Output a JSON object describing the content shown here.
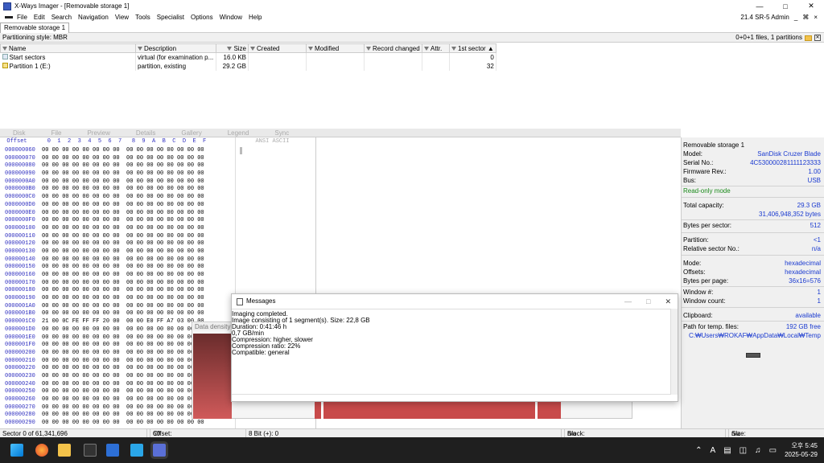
{
  "window": {
    "title": "X-Ways Imager - [Removable storage 1]",
    "version_label": "21.4 SR-5 Admin"
  },
  "menu": [
    "File",
    "Edit",
    "Search",
    "Navigation",
    "View",
    "Tools",
    "Specialist",
    "Options",
    "Window",
    "Help"
  ],
  "menu_right": {
    "minimize": "_",
    "restore": "×",
    "extra": "⌘"
  },
  "tab": {
    "label": "Removable storage 1"
  },
  "infobar": {
    "left": "Partitioning style: MBR",
    "right": "0+0+1 files, 1 partitions"
  },
  "filelist": {
    "columns": [
      "Name",
      "Description",
      "Size",
      "Created",
      "Modified",
      "Record changed",
      "Attr.",
      "1st sector"
    ],
    "rows": [
      {
        "name": "Start sectors",
        "description": "virtual (for examination p...",
        "size": "16.0 KB",
        "created": "",
        "modified": "",
        "record": "",
        "attr": "",
        "sector": "0"
      },
      {
        "name": "Partition 1 (E:)",
        "description": "partition, existing",
        "size": "29.2 GB",
        "created": "",
        "modified": "",
        "record": "",
        "attr": "",
        "sector": "32"
      }
    ]
  },
  "viewtabs": [
    "Disk",
    "File",
    "Preview",
    "Details",
    "Gallery",
    "Legend",
    "",
    "",
    "Sync",
    ""
  ],
  "hex": {
    "header": "  Offset      0  1  2  3  4  5  6  7   8  9  A  B  C  D  E  F",
    "ascii_header": "ANSI ASCII",
    "rows": [
      {
        "off": "000000060",
        "bytes": "00 00 00 00 00 00 00 00  00 00 00 00 00 00 00 00"
      },
      {
        "off": "000000070",
        "bytes": "00 00 00 00 00 00 00 00  00 00 00 00 00 00 00 00"
      },
      {
        "off": "000000080",
        "bytes": "00 00 00 00 00 00 00 00  00 00 00 00 00 00 00 00"
      },
      {
        "off": "000000090",
        "bytes": "00 00 00 00 00 00 00 00  00 00 00 00 00 00 00 00"
      },
      {
        "off": "0000000A0",
        "bytes": "00 00 00 00 00 00 00 00  00 00 00 00 00 00 00 00"
      },
      {
        "off": "0000000B0",
        "bytes": "00 00 00 00 00 00 00 00  00 00 00 00 00 00 00 00"
      },
      {
        "off": "0000000C0",
        "bytes": "00 00 00 00 00 00 00 00  00 00 00 00 00 00 00 00"
      },
      {
        "off": "0000000D0",
        "bytes": "00 00 00 00 00 00 00 00  00 00 00 00 00 00 00 00"
      },
      {
        "off": "0000000E0",
        "bytes": "00 00 00 00 00 00 00 00  00 00 00 00 00 00 00 00"
      },
      {
        "off": "0000000F0",
        "bytes": "00 00 00 00 00 00 00 00  00 00 00 00 00 00 00 00"
      },
      {
        "off": "000000100",
        "bytes": "00 00 00 00 00 00 00 00  00 00 00 00 00 00 00 00"
      },
      {
        "off": "000000110",
        "bytes": "00 00 00 00 00 00 00 00  00 00 00 00 00 00 00 00"
      },
      {
        "off": "000000120",
        "bytes": "00 00 00 00 00 00 00 00  00 00 00 00 00 00 00 00"
      },
      {
        "off": "000000130",
        "bytes": "00 00 00 00 00 00 00 00  00 00 00 00 00 00 00 00"
      },
      {
        "off": "000000140",
        "bytes": "00 00 00 00 00 00 00 00  00 00 00 00 00 00 00 00"
      },
      {
        "off": "000000150",
        "bytes": "00 00 00 00 00 00 00 00  00 00 00 00 00 00 00 00"
      },
      {
        "off": "000000160",
        "bytes": "00 00 00 00 00 00 00 00  00 00 00 00 00 00 00 00"
      },
      {
        "off": "000000170",
        "bytes": "00 00 00 00 00 00 00 00  00 00 00 00 00 00 00 00"
      },
      {
        "off": "000000180",
        "bytes": "00 00 00 00 00 00 00 00  00 00 00 00 00 00 00 00"
      },
      {
        "off": "000000190",
        "bytes": "00 00 00 00 00 00 00 00  00 00 00 00 00 00 00 00"
      },
      {
        "off": "0000001A0",
        "bytes": "00 00 00 00 00 00 00 00  00 00 00 00 00 00 00 00"
      },
      {
        "off": "0000001B0",
        "bytes": "00 00 00 00 00 00 00 00  00 00 00 00 00 00 00 00"
      },
      {
        "off": "0000001C0",
        "bytes": "21 00 0C FE FF FF 20 00  00 00 E0 FF A7 03 00 00"
      },
      {
        "off": "0000001D0",
        "bytes": "00 00 00 00 00 00 00 00  00 00 00 00 00 00 00 00"
      },
      {
        "off": "0000001E0",
        "bytes": "00 00 00 00 00 00 00 00  00 00 00 00 00 00 00 00"
      },
      {
        "off": "0000001F0",
        "bytes": "00 00 00 00 00 00 00 00  00 00 00 00 00 00 00 00"
      },
      {
        "off": "000000200",
        "bytes": "00 00 00 00 00 00 00 00  00 00 00 00 00 00 00 00"
      },
      {
        "off": "000000210",
        "bytes": "00 00 00 00 00 00 00 00  00 00 00 00 00 00 00 00"
      },
      {
        "off": "000000220",
        "bytes": "00 00 00 00 00 00 00 00  00 00 00 00 00 00 00 00"
      },
      {
        "off": "000000230",
        "bytes": "00 00 00 00 00 00 00 00  00 00 00 00 00 00 00 00"
      },
      {
        "off": "000000240",
        "bytes": "00 00 00 00 00 00 00 00  00 00 00 00 00 00 00 00"
      },
      {
        "off": "000000250",
        "bytes": "00 00 00 00 00 00 00 00  00 00 00 00 00 00 00 00"
      },
      {
        "off": "000000260",
        "bytes": "00 00 00 00 00 00 00 00  00 00 00 00 00 00 00 00"
      },
      {
        "off": "000000270",
        "bytes": "00 00 00 00 00 00 00 00  00 00 00 00 00 00 00 00"
      },
      {
        "off": "000000280",
        "bytes": "00 00 00 00 00 00 00 00  00 00 00 00 00 00 00 00"
      },
      {
        "off": "000000290",
        "bytes": "00 00 00 00 00 00 00 00  00 00 00 00 00 00 00 00"
      }
    ]
  },
  "info": {
    "title": "Removable storage 1",
    "model_label": "Model:",
    "model": "SanDisk Cruzer Blade",
    "serial_label": "Serial No.:",
    "serial": "4C530000281111123333",
    "firmware_label": "Firmware Rev.:",
    "firmware": "1.00",
    "bus_label": "Bus:",
    "bus": "USB",
    "readonly": "Read-only mode",
    "capacity_label": "Total capacity:",
    "capacity": "29.3 GB",
    "capacity_bytes": "31,406,948,352 bytes",
    "bps_label": "Bytes per sector:",
    "bps": "512",
    "partition_label": "Partition:",
    "partition": "<1",
    "relsector_label": "Relative sector No.:",
    "relsector": "n/a",
    "mode_label": "Mode:",
    "mode": "hexadecimal",
    "offsets_label": "Offsets:",
    "offsets": "hexadecimal",
    "bpp_label": "Bytes per page:",
    "bpp": "36x16=576",
    "window_label": "Window #:",
    "window": "1",
    "wincount_label": "Window count:",
    "wincount": "1",
    "clipboard_label": "Clipboard:",
    "clipboard": "available",
    "temp_label": "Path for temp. files:",
    "temp_free": "192 GB free",
    "temp_path": "C:₩Users₩ROKAF₩AppData₩Local₩Temp"
  },
  "density": {
    "label": "Data density"
  },
  "messages": {
    "title": "Messages",
    "lines": [
      "Imaging completed.",
      "Image consisting of 1 segment(s). Size: 22,8 GB",
      "Duration: 0:41:46 h",
      "0,7 GB/min",
      "Compression: higher, slower",
      "Compression ratio: 22%",
      "Compatible: general"
    ]
  },
  "status": {
    "sector": "Sector 0 of 61,341,696",
    "offset": "Offset:",
    "offset_val": "60",
    "bits": "8 Bit (+): 0",
    "block": "Block:",
    "block_val": "n/a",
    "size": "Size:",
    "size_val": "n/a"
  },
  "taskbar": {
    "time": "오후 5:45",
    "date": "2025-05-29",
    "ime": "A"
  }
}
